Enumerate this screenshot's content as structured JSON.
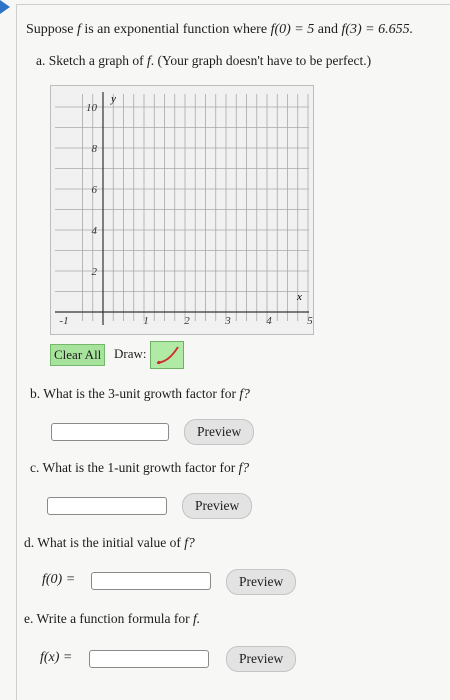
{
  "problem": {
    "prefix": "Suppose",
    "f_name": "f",
    "middle": "is an exponential function where",
    "cond1": "f(0) = 5",
    "and": "and",
    "cond2": "f(3) = 6.655."
  },
  "part_a": {
    "prompt": "a. Sketch a graph of",
    "f_name": "f",
    "suffix": ". (Your graph doesn't have to be perfect.)"
  },
  "graph": {
    "y_axis_label": "y",
    "x_axis_label": "x",
    "y_ticks": [
      "10",
      "8",
      "6",
      "4",
      "2"
    ],
    "x_ticks": [
      "-1",
      "1",
      "2",
      "3",
      "4",
      "5"
    ],
    "clear_all_label": "Clear All",
    "draw_label": "Draw:",
    "colors": {
      "button_green": "#a7e39c",
      "curve_red": "#d22b2b"
    }
  },
  "part_b": {
    "prompt": "b. What is the 3-unit growth factor for",
    "f_name": "f?",
    "input_value": "",
    "preview_label": "Preview"
  },
  "part_c": {
    "prompt": "c. What is the 1-unit growth factor for",
    "f_name": "f?",
    "input_value": "",
    "preview_label": "Preview"
  },
  "part_d": {
    "prompt": "d. What is the initial value of",
    "f_name": "f?",
    "field_label": "f(0) =",
    "input_value": "",
    "preview_label": "Preview"
  },
  "part_e": {
    "prompt": "e. Write a function formula for",
    "f_name": "f.",
    "field_label": "f(x) =",
    "input_value": "",
    "preview_label": "Preview"
  }
}
